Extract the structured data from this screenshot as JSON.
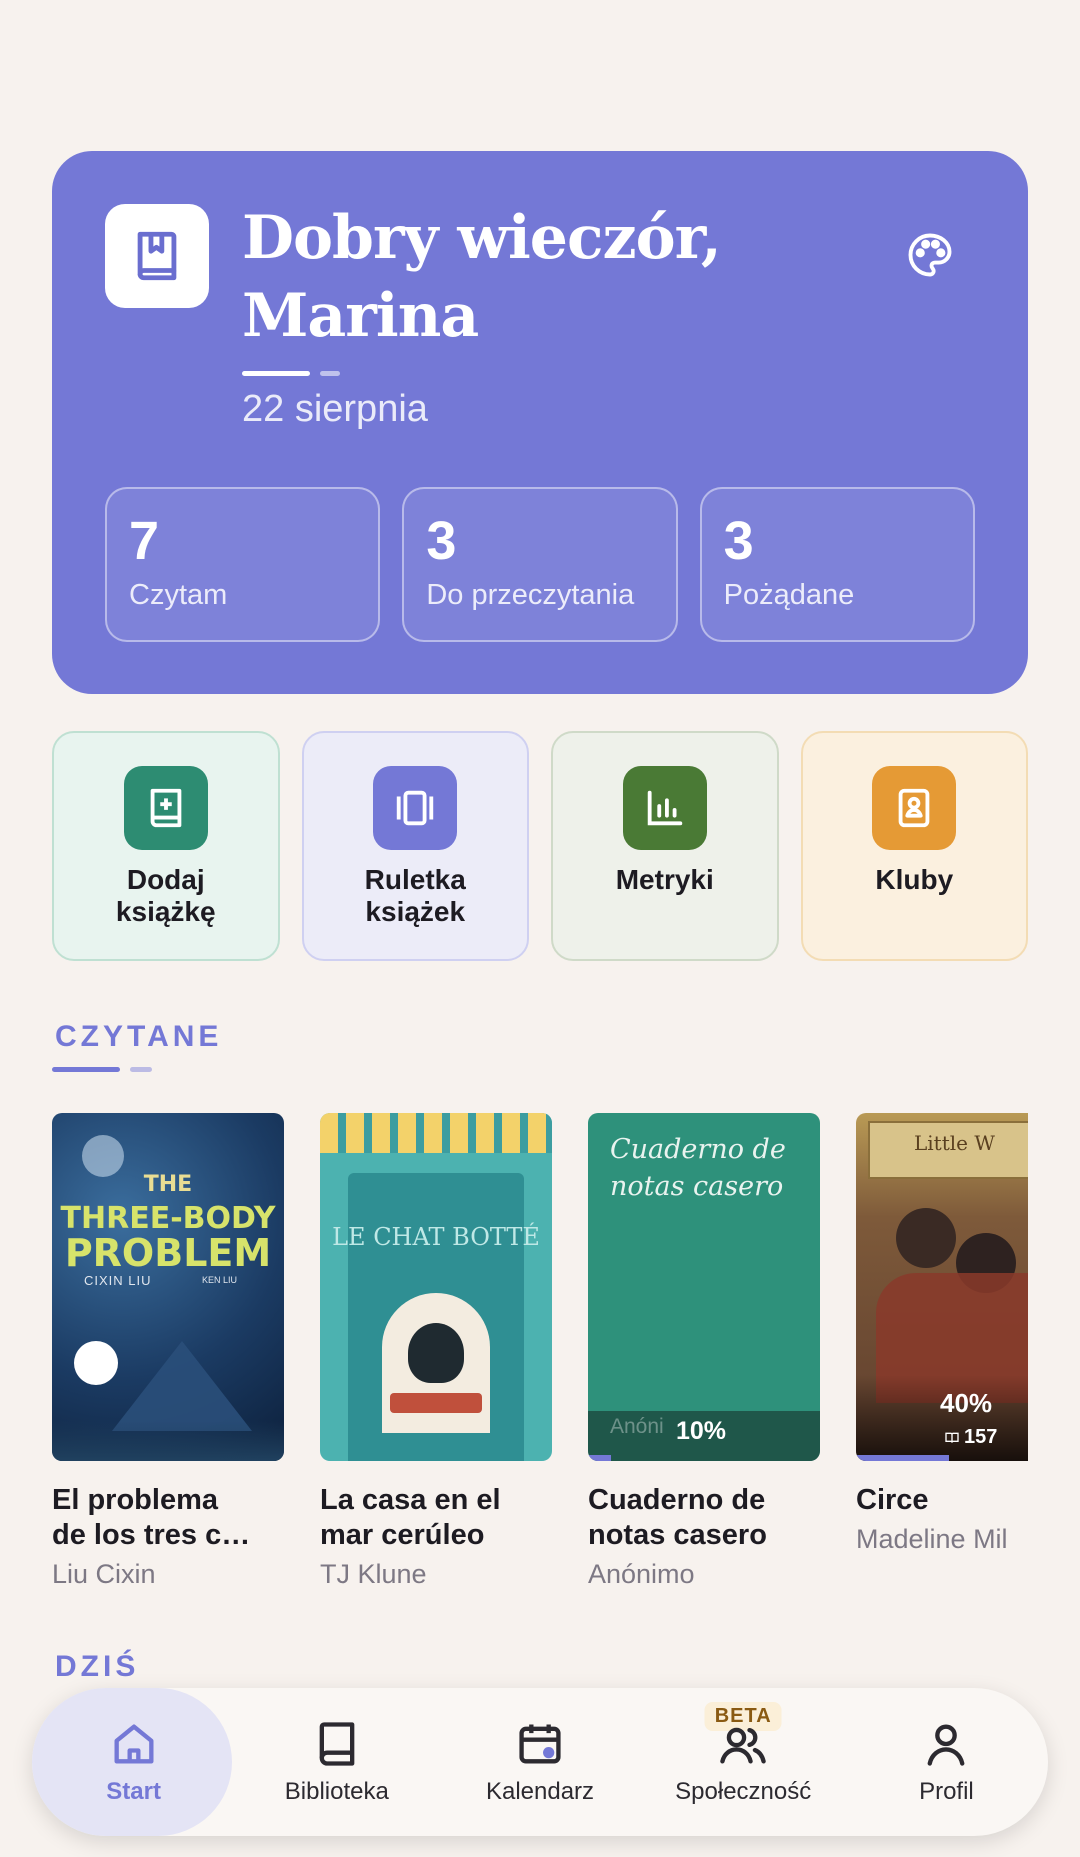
{
  "hero": {
    "greeting": "Dobry wieczór, Marina",
    "date": "22 sierpnia",
    "stats": [
      {
        "value": "7",
        "label": "Czytam"
      },
      {
        "value": "3",
        "label": "Do przeczytania"
      },
      {
        "value": "3",
        "label": "Pożądane"
      }
    ]
  },
  "actions": [
    {
      "label": "Dodaj książkę",
      "icon": "add-book-icon"
    },
    {
      "label": "Ruletka książek",
      "icon": "roulette-icon"
    },
    {
      "label": "Metryki",
      "icon": "chart-icon"
    },
    {
      "label": "Kluby",
      "icon": "club-icon"
    }
  ],
  "sections": {
    "reading": "CZYTANE",
    "today": "DZIŚ"
  },
  "books": [
    {
      "title": "El problema de los tres c…",
      "title_line1": "El problema",
      "title_line2": "de los tres c…",
      "author": "Liu Cixin",
      "cover": {
        "line1": "THE",
        "line2": "THREE-BODY",
        "line3": "PROBLEM",
        "author": "CIXIN LIU",
        "translator": "KEN LIU"
      }
    },
    {
      "title_line1": "La casa en el",
      "title_line2": "mar cerúleo",
      "author": "TJ Klune",
      "cover": {
        "title": "LE CHAT BOTTÉ"
      }
    },
    {
      "title_line1": "Cuaderno de",
      "title_line2": "notas casero",
      "author": "Anónimo",
      "cover": {
        "title": "Cuaderno de notas casero",
        "author_faded": "Anóni",
        "progress": "10%",
        "progress_value": 0.1
      }
    },
    {
      "title_line1": "Circe",
      "title_line2": "",
      "author": "Madeline Mil",
      "cover": {
        "title": "Little W",
        "progress": "40%",
        "pages": "157",
        "progress_value": 0.4
      }
    }
  ],
  "nav": [
    {
      "label": "Start",
      "icon": "home-icon",
      "active": true
    },
    {
      "label": "Biblioteka",
      "icon": "library-icon"
    },
    {
      "label": "Kalendarz",
      "icon": "calendar-icon"
    },
    {
      "label": "Społeczność",
      "icon": "community-icon",
      "badge": "BETA"
    },
    {
      "label": "Profil",
      "icon": "profile-icon"
    }
  ],
  "colors": {
    "accent": "#7478d6",
    "background": "#f7f2ee",
    "add": "#2d8c72",
    "metrics": "#4a7a35",
    "clubs": "#e59a35"
  }
}
